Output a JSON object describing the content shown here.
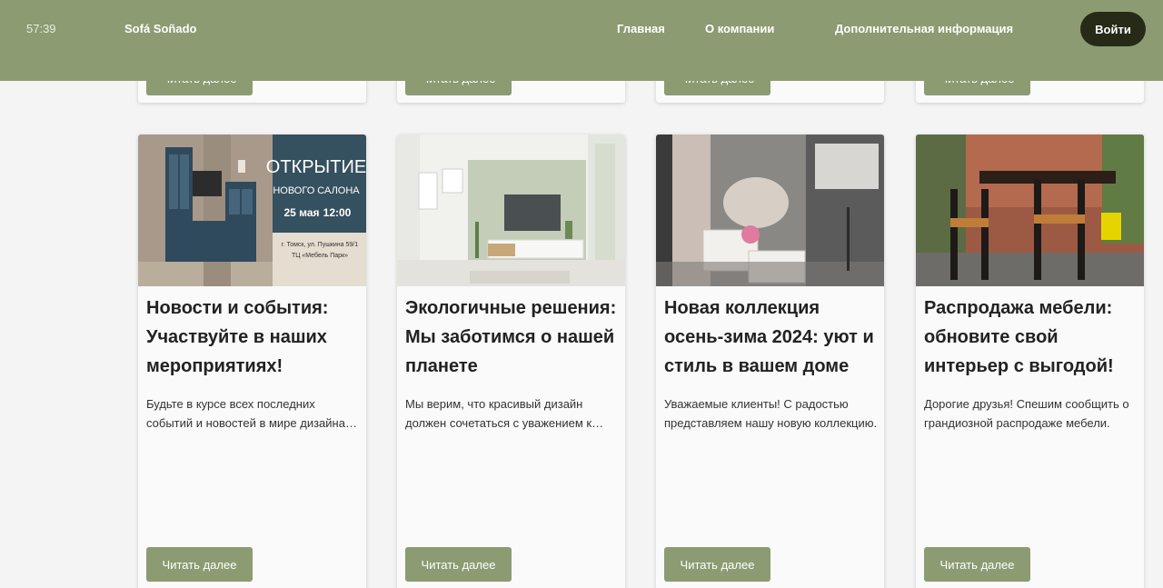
{
  "header": {
    "timer": "57:39",
    "brand": "Sofá Soñado",
    "nav": [
      "Главная",
      "О компании",
      "Дополнительная информация"
    ],
    "login": "Войти"
  },
  "read_more": "Читать далее",
  "cards": [
    {
      "title": "Новости и события: Участвуйте в наших мероприятиях!",
      "excerpt": "Будьте в курсе всех последних событий и новостей в мире дизайна и мебели.",
      "image": {
        "line1": "ОТКРЫТИЕ",
        "line2": "НОВОГО САЛОНА",
        "date": "25 мая",
        "time": "12:00",
        "address": "г. Томск, ул. Пушкина 59/1",
        "place": "ТЦ «Мебель Парк»"
      }
    },
    {
      "title": "Экологичные решения: Мы заботимся о нашей планете",
      "excerpt": "Мы верим, что красивый дизайн должен сочетаться с уважением к природе."
    },
    {
      "title": "Новая коллекция осень-зима 2024: уют и стиль в вашем доме",
      "excerpt": "Уважаемые клиенты! С радостью представляем нашу новую коллекцию."
    },
    {
      "title": "Распродажа мебели: обновите свой интерьер с выгодой!",
      "excerpt": "Дорогие друзья! Спешим сообщить о грандиозной распродаже мебели."
    }
  ],
  "colors": {
    "header_bg": "#8c9b72",
    "login_bg": "#272a17",
    "button_bg": "#8c9b72"
  }
}
